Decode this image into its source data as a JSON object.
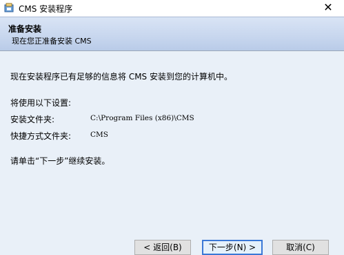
{
  "window": {
    "title": "CMS 安装程序",
    "close_glyph": "✕",
    "icon": "installer-app-icon"
  },
  "header": {
    "title": "准备安装",
    "subtitle": "现在您正准备安装 CMS"
  },
  "content": {
    "intro": "现在安装程序已有足够的信息将 CMS 安装到您的计算机中。",
    "settings_heading": "将使用以下设置:",
    "install_folder_label": "安装文件夹:",
    "install_folder_value": "C:\\Program Files (x86)\\CMS",
    "shortcut_folder_label": "快捷方式文件夹:",
    "shortcut_folder_value": "CMS",
    "instruction": "请单击“下一步”继续安装。"
  },
  "buttons": {
    "back": "< 返回(B)",
    "next": "下一步(N) >",
    "cancel": "取消(C)"
  },
  "colors": {
    "header_gradient_top": "#d9e4f5",
    "header_gradient_bottom": "#b9cbe8",
    "body_background": "#e9f0f8",
    "primary_button_border": "#3a78d6"
  }
}
